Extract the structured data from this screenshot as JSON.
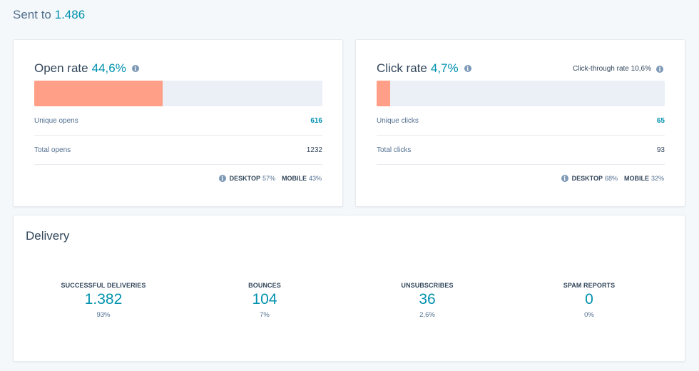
{
  "header": {
    "sent_to_label": "Sent to",
    "sent_to_value": "1.486"
  },
  "open_card": {
    "title": "Open rate",
    "rate": "44,6%",
    "rate_fraction": 0.446,
    "info_icon": "info-icon",
    "rows": [
      {
        "label": "Unique opens",
        "value": "616"
      },
      {
        "label": "Total opens",
        "value": "1232"
      }
    ],
    "devices": {
      "desktop_label": "DESKTOP",
      "desktop_value": "57%",
      "mobile_label": "MOBILE",
      "mobile_value": "43%"
    }
  },
  "click_card": {
    "title": "Click rate",
    "rate": "4,7%",
    "rate_fraction": 0.047,
    "ctr_label": "Click-through rate 10,6%",
    "info_icon": "info-icon",
    "rows": [
      {
        "label": "Unique clicks",
        "value": "65"
      },
      {
        "label": "Total clicks",
        "value": "93"
      }
    ],
    "devices": {
      "desktop_label": "DESKTOP",
      "desktop_value": "68%",
      "mobile_label": "MOBILE",
      "mobile_value": "32%"
    }
  },
  "delivery": {
    "title": "Delivery",
    "metrics": [
      {
        "label": "SUCCESSFUL DELIVERIES",
        "value": "1.382",
        "percent": "93%"
      },
      {
        "label": "BOUNCES",
        "value": "104",
        "percent": "7%"
      },
      {
        "label": "UNSUBSCRIBES",
        "value": "36",
        "percent": "2,6%"
      },
      {
        "label": "SPAM REPORTS",
        "value": "0",
        "percent": "0%"
      }
    ]
  },
  "colors": {
    "accent": "#0091ae",
    "bar_fill": "#ff9f87",
    "bar_track": "#eaf0f6",
    "background": "#f5f8fa"
  }
}
